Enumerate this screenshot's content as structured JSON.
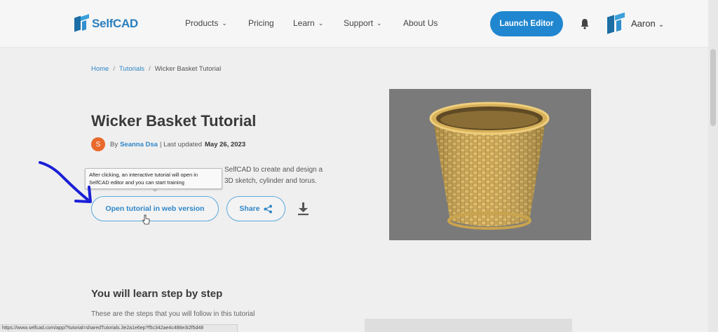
{
  "header": {
    "logo_text": "SelfCAD",
    "nav": [
      {
        "label": "Products",
        "dropdown": true
      },
      {
        "label": "Pricing",
        "dropdown": false
      },
      {
        "label": "Learn",
        "dropdown": true
      },
      {
        "label": "Support",
        "dropdown": true
      },
      {
        "label": "About Us",
        "dropdown": false
      }
    ],
    "launch_label": "Launch Editor",
    "user_name": "Aaron"
  },
  "breadcrumb": [
    "Home",
    "Tutorials",
    "Wicker Basket Tutorial"
  ],
  "page_title": "Wicker Basket Tutorial",
  "byline": {
    "avatar_letter": "S",
    "by": "By",
    "author": "Seanna Dsa",
    "updated_label": "| Last updated",
    "date": "May 26, 2023"
  },
  "description": {
    "line1_visible": "SelfCAD to create and design a",
    "line2_visible": "3D sketch, cylinder and torus."
  },
  "tooltip": "After clicking, an interactive tutorial will open in SelfCAD editor and you can start training",
  "buttons": {
    "open_tutorial": "Open tutorial in web version",
    "share": "Share"
  },
  "section": {
    "title": "You will learn step by step",
    "desc": "These are the steps that you will follow in this tutorial"
  },
  "status_url": "https://www.selfcad.com/app/?tutorial=sharedTutorials.3e2a1e6ep?f5c342ae4c486e3i2f5d48",
  "colors": {
    "accent": "#1f86cf",
    "link": "#2f86c8",
    "author_avatar": "#e9692c",
    "annotation": "#1a1fd6"
  },
  "icons": [
    "bell-icon",
    "share-icon",
    "download-icon",
    "chevron-down-icon",
    "cursor-icon"
  ]
}
